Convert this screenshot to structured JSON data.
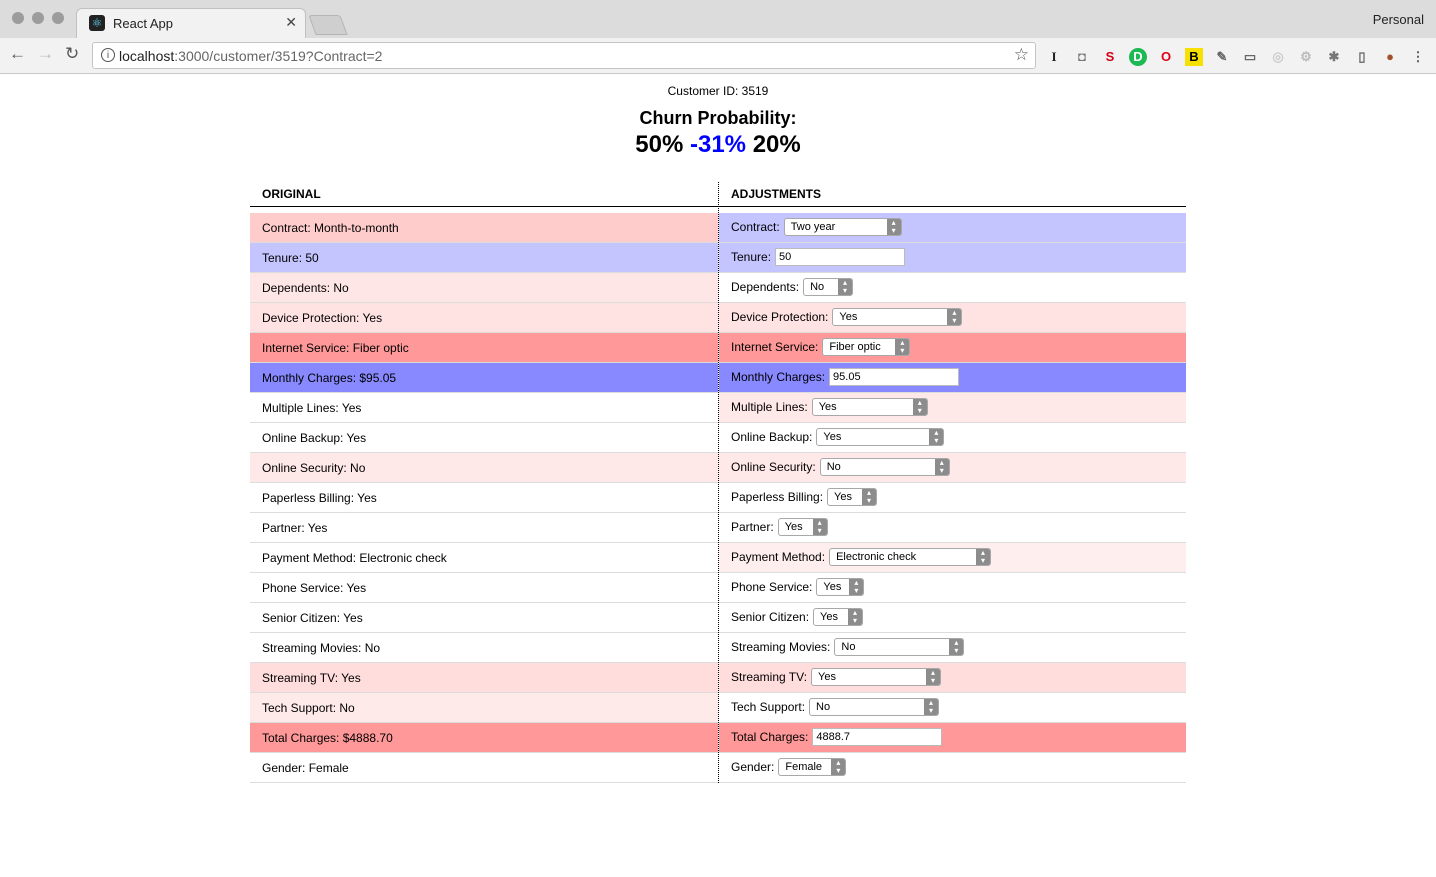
{
  "browser": {
    "tab_title": "React App",
    "favicon": "react-logo",
    "profile": "Personal",
    "url_host": "localhost",
    "url_rest": ":3000/customer/3519?Contract=2"
  },
  "page": {
    "customer_id": "Customer ID: 3519",
    "churn_label": "Churn Probability:",
    "churn_original": "50%",
    "churn_delta": "-31%",
    "churn_adjusted": "20%"
  },
  "table": {
    "header_original": "ORIGINAL",
    "header_adjustments": "ADJUSTMENTS",
    "rows": [
      {
        "original": "Contract: Month-to-month",
        "label": "Contract:",
        "control": "select",
        "value": "Two year",
        "bg": "#ffcccc",
        "adj_bg": "#c4c4ff"
      },
      {
        "original": "Tenure: 50",
        "label": "Tenure:",
        "control": "input",
        "value": "50",
        "bg": "#c4c4ff",
        "adj_bg": "#c4c4ff"
      },
      {
        "original": "Dependents: No",
        "label": "Dependents:",
        "control": "select",
        "value": "No",
        "bg": "#ffe6e6",
        "adj_bg": "#ffffff"
      },
      {
        "original": "Device Protection: Yes",
        "label": "Device Protection:",
        "control": "select",
        "value": "Yes",
        "bg": "#ffe2e2",
        "adj_bg": "#ffe2e2"
      },
      {
        "original": "Internet Service: Fiber optic",
        "label": "Internet Service:",
        "control": "select",
        "value": "Fiber optic",
        "bg": "#ff9999",
        "adj_bg": "#ff9999"
      },
      {
        "original": "Monthly Charges: $95.05",
        "label": "Monthly Charges:",
        "control": "input",
        "value": "95.05",
        "bg": "#8888ff",
        "adj_bg": "#8888ff"
      },
      {
        "original": "Multiple Lines: Yes",
        "label": "Multiple Lines:",
        "control": "select",
        "value": "Yes",
        "bg": "#ffffff",
        "adj_bg": "#ffe8e8"
      },
      {
        "original": "Online Backup: Yes",
        "label": "Online Backup:",
        "control": "select",
        "value": "Yes",
        "bg": "#ffffff",
        "adj_bg": "#ffffff"
      },
      {
        "original": "Online Security: No",
        "label": "Online Security:",
        "control": "select",
        "value": "No",
        "bg": "#ffe8e8",
        "adj_bg": "#ffe8e8"
      },
      {
        "original": "Paperless Billing: Yes",
        "label": "Paperless Billing:",
        "control": "select",
        "value": "Yes",
        "bg": "#ffffff",
        "adj_bg": "#ffffff"
      },
      {
        "original": "Partner: Yes",
        "label": "Partner:",
        "control": "select",
        "value": "Yes",
        "bg": "#ffffff",
        "adj_bg": "#ffffff"
      },
      {
        "original": "Payment Method: Electronic check",
        "label": "Payment Method:",
        "control": "select",
        "value": "Electronic check",
        "bg": "#ffffff",
        "adj_bg": "#ffeeee"
      },
      {
        "original": "Phone Service: Yes",
        "label": "Phone Service:",
        "control": "select",
        "value": "Yes",
        "bg": "#ffffff",
        "adj_bg": "#ffffff"
      },
      {
        "original": "Senior Citizen: Yes",
        "label": "Senior Citizen:",
        "control": "select",
        "value": "Yes",
        "bg": "#ffffff",
        "adj_bg": "#ffffff"
      },
      {
        "original": "Streaming Movies: No",
        "label": "Streaming Movies:",
        "control": "select",
        "value": "No",
        "bg": "#ffffff",
        "adj_bg": "#ffffff"
      },
      {
        "original": "Streaming TV: Yes",
        "label": "Streaming TV:",
        "control": "select",
        "value": "Yes",
        "bg": "#ffdddd",
        "adj_bg": "#ffdddd"
      },
      {
        "original": "Tech Support: No",
        "label": "Tech Support:",
        "control": "select",
        "value": "No",
        "bg": "#ffeaea",
        "adj_bg": "#ffffff"
      },
      {
        "original": "Total Charges: $4888.70",
        "label": "Total Charges:",
        "control": "input",
        "value": "4888.7",
        "bg": "#ff9999",
        "adj_bg": "#ff9999"
      },
      {
        "original": "Gender: Female",
        "label": "Gender:",
        "control": "select",
        "value": "Female",
        "bg": "#ffffff",
        "adj_bg": "#ffffff"
      }
    ]
  }
}
